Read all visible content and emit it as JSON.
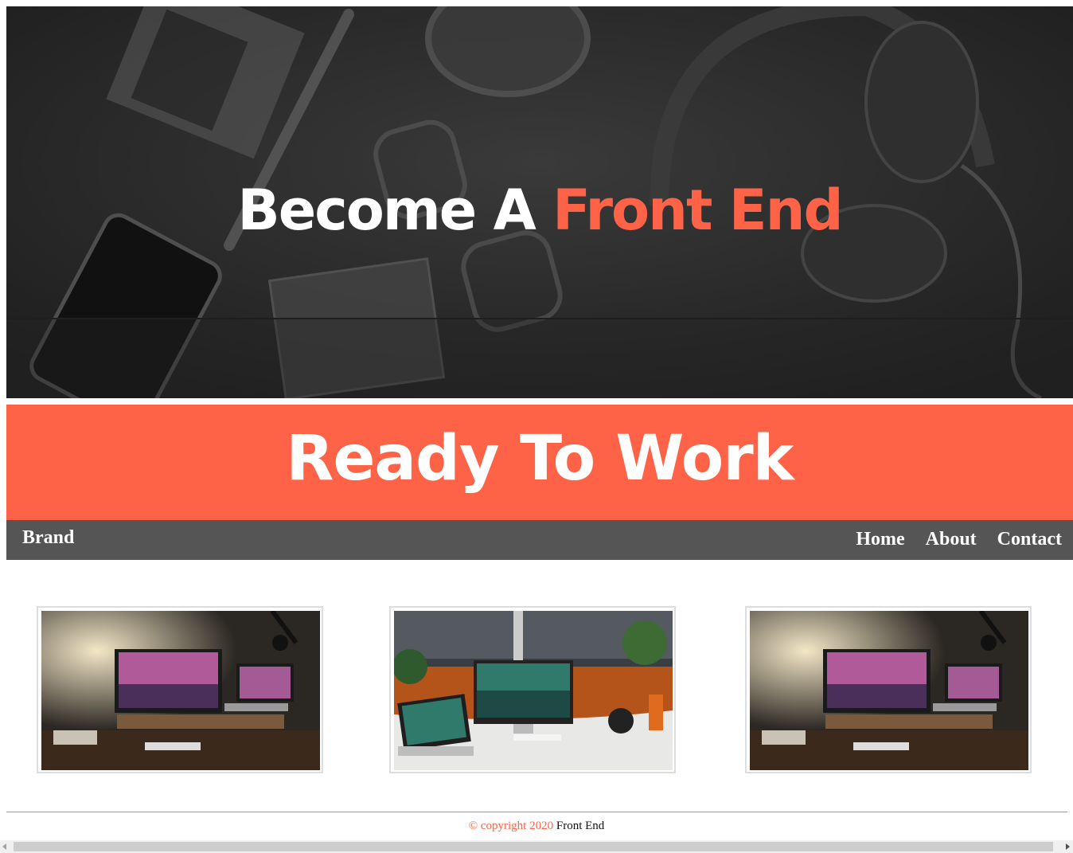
{
  "hero": {
    "title_part1": "Become A ",
    "title_accent": "Front End"
  },
  "banner": {
    "text": "Ready To Work"
  },
  "navbar": {
    "brand": "Brand",
    "links": [
      "Home",
      "About",
      "Contact"
    ]
  },
  "gallery": {
    "items": [
      {
        "icon": "desk-setup-photo"
      },
      {
        "icon": "office-desk-photo"
      },
      {
        "icon": "desk-setup-photo"
      }
    ]
  },
  "footer": {
    "copyright": "© copyright 2020",
    "name": "Front End"
  },
  "colors": {
    "accent": "#ff6347",
    "navbar": "#555555",
    "hero_bg": "#262626"
  }
}
